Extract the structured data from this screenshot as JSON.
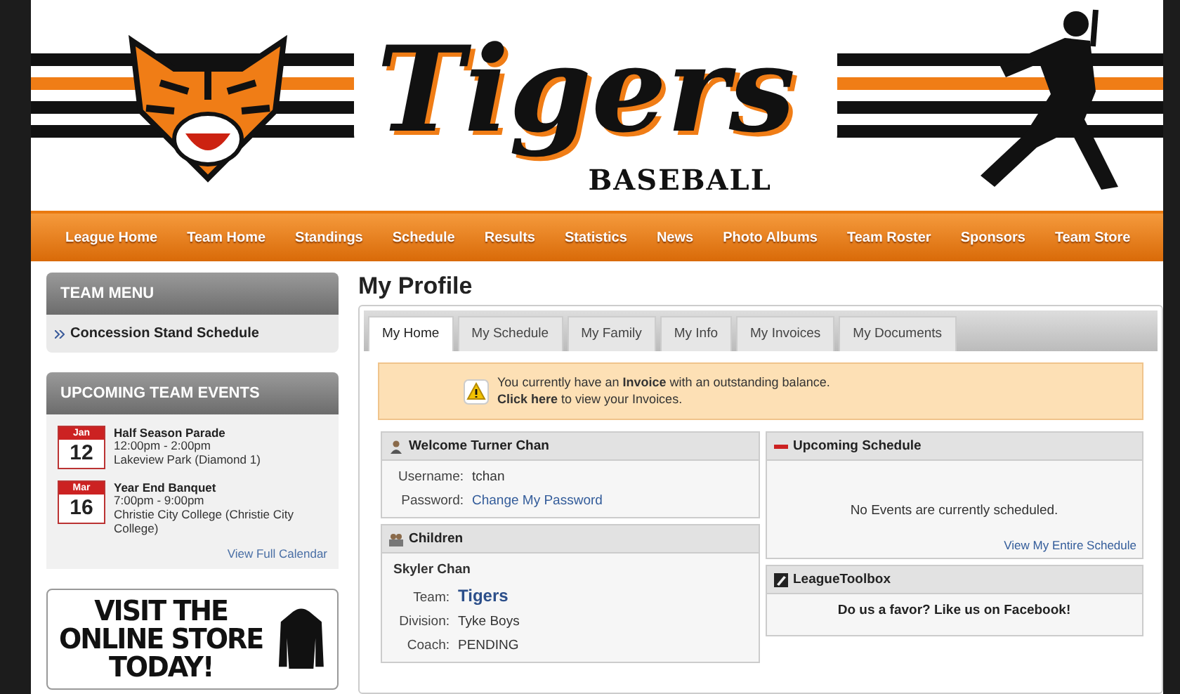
{
  "banner": {
    "logo_text": "Tigers",
    "subtitle": "BASEBALL"
  },
  "nav": [
    {
      "label": "League Home"
    },
    {
      "label": "Team Home"
    },
    {
      "label": "Standings"
    },
    {
      "label": "Schedule"
    },
    {
      "label": "Results"
    },
    {
      "label": "Statistics"
    },
    {
      "label": "News"
    },
    {
      "label": "Photo Albums"
    },
    {
      "label": "Team Roster"
    },
    {
      "label": "Sponsors"
    },
    {
      "label": "Team Store"
    }
  ],
  "sidebar": {
    "team_menu": {
      "title": "TEAM MENU",
      "items": [
        {
          "label": "Concession Stand Schedule"
        }
      ]
    },
    "events": {
      "title": "UPCOMING TEAM EVENTS",
      "items": [
        {
          "month": "Jan",
          "day": "12",
          "name": "Half Season Parade",
          "time": "12:00pm - 2:00pm",
          "location": "Lakeview Park (Diamond 1)"
        },
        {
          "month": "Mar",
          "day": "16",
          "name": "Year End Banquet",
          "time": "7:00pm - 9:00pm",
          "location": "Christie City College (Christie City College)"
        }
      ],
      "link": "View Full Calendar"
    },
    "store_ad": {
      "lines": [
        "VISIT THE",
        "ONLINE STORE",
        "TODAY!"
      ]
    }
  },
  "main": {
    "title": "My Profile",
    "tabs": [
      {
        "label": "My Home",
        "selected": true
      },
      {
        "label": "My Schedule",
        "selected": false
      },
      {
        "label": "My Family",
        "selected": false
      },
      {
        "label": "My Info",
        "selected": false
      },
      {
        "label": "My Invoices",
        "selected": false
      },
      {
        "label": "My Documents",
        "selected": false
      }
    ],
    "alert": {
      "line1": "You currently have an **Invoice** with an outstanding balance.",
      "line2": "**Click here** to view your Invoices."
    },
    "welcome": {
      "title": "Welcome Turner Chan",
      "fields": [
        {
          "label": "Username:",
          "value": "tchan",
          "kind": "text"
        },
        {
          "label": "Password:",
          "value": "Change My Password",
          "kind": "link"
        }
      ]
    },
    "children": {
      "title": "Children",
      "child_name": "Skyler Chan",
      "fields": [
        {
          "label": "Team:",
          "value": "Tigers",
          "kind": "team"
        },
        {
          "label": "Division:",
          "value": "Tyke Boys",
          "kind": "text"
        },
        {
          "label": "Coach:",
          "value": "PENDING",
          "kind": "text"
        }
      ]
    },
    "schedule": {
      "title": "Upcoming Schedule",
      "empty": "No Events are currently scheduled.",
      "link": "View My Entire Schedule"
    },
    "toolbox": {
      "title": "LeagueToolbox",
      "message": "Do us a favor? Like us on Facebook!"
    }
  }
}
